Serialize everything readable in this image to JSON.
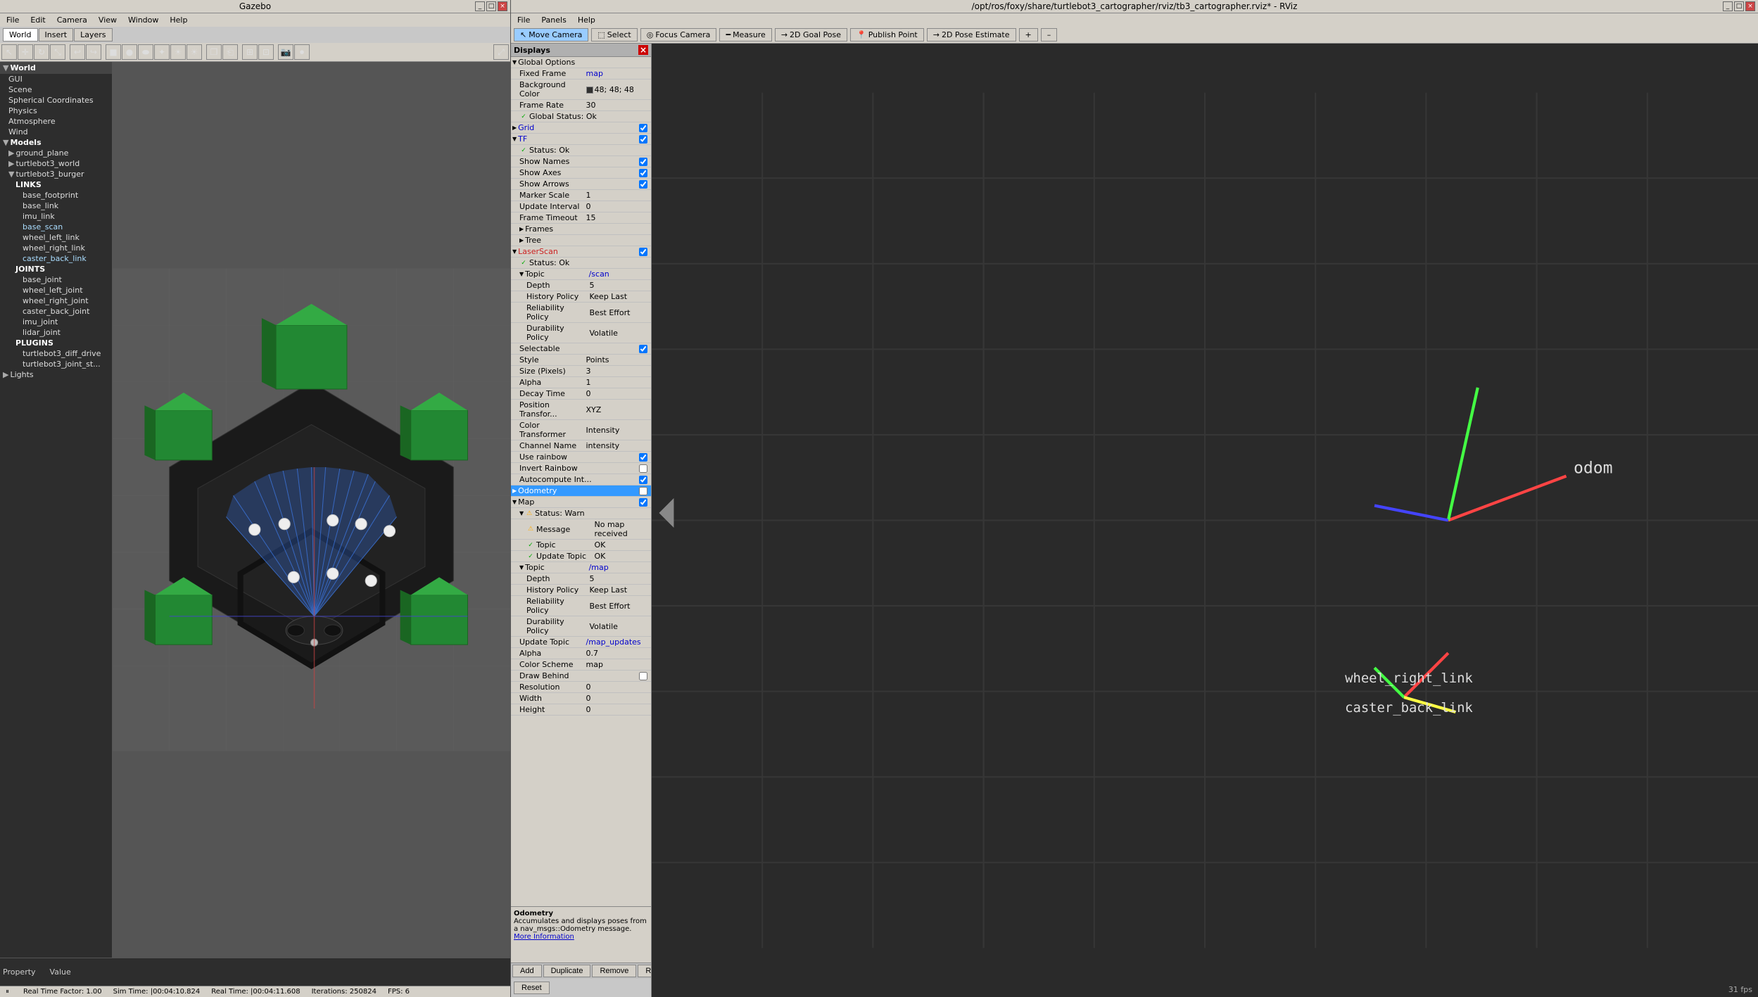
{
  "gazebo": {
    "title": "Gazebo",
    "menubar": [
      "File",
      "Edit",
      "Camera",
      "View",
      "Window",
      "Help"
    ],
    "tabs": [
      "World",
      "Insert",
      "Layers"
    ],
    "active_tab": "World",
    "sidebar": {
      "world_items": [
        {
          "label": "GUI",
          "indent": 1
        },
        {
          "label": "Scene",
          "indent": 1
        },
        {
          "label": "Spherical Coordinates",
          "indent": 1
        },
        {
          "label": "Physics",
          "indent": 1
        },
        {
          "label": "Atmosphere",
          "indent": 1
        },
        {
          "label": "Wind",
          "indent": 1
        },
        {
          "label": "Models",
          "indent": 0,
          "bold": true,
          "expanded": true
        },
        {
          "label": "ground_plane",
          "indent": 1
        },
        {
          "label": "turtlebot3_world",
          "indent": 1
        },
        {
          "label": "turtlebot3_burger",
          "indent": 1,
          "expanded": true
        },
        {
          "label": "LINKS",
          "indent": 2,
          "bold": true
        },
        {
          "label": "base_footprint",
          "indent": 3
        },
        {
          "label": "base_link",
          "indent": 3
        },
        {
          "label": "imu_link",
          "indent": 3
        },
        {
          "label": "base_scan",
          "indent": 3
        },
        {
          "label": "wheel_left_link",
          "indent": 3
        },
        {
          "label": "wheel_right_link",
          "indent": 3
        },
        {
          "label": "caster_back_link",
          "indent": 3
        },
        {
          "label": "JOINTS",
          "indent": 2,
          "bold": true
        },
        {
          "label": "base_joint",
          "indent": 3
        },
        {
          "label": "wheel_left_joint",
          "indent": 3
        },
        {
          "label": "wheel_right_joint",
          "indent": 3
        },
        {
          "label": "caster_back_joint",
          "indent": 3
        },
        {
          "label": "imu_joint",
          "indent": 3
        },
        {
          "label": "lidar_joint",
          "indent": 3
        },
        {
          "label": "PLUGINS",
          "indent": 2,
          "bold": true
        },
        {
          "label": "turtlebot3_diff_drive",
          "indent": 3
        },
        {
          "label": "turtlebot3_joint_st...",
          "indent": 3
        },
        {
          "label": "Lights",
          "indent": 0,
          "bold": false
        }
      ]
    },
    "props": {
      "property_label": "Property",
      "value_label": "Value"
    },
    "status": {
      "real_time_factor": "Real Time Factor: 1.00",
      "sim_time": "Sim Time: |00:04:10.824",
      "real_time": "Real Time: |00:04:11.608",
      "iterations": "Iterations: 250824",
      "fps": "FPS: 6"
    }
  },
  "rviz": {
    "title": "/opt/ros/foxy/share/turtlebot3_cartographer/rviz/tb3_cartographer.rviz* - RViz",
    "menubar": [
      "File",
      "Panels",
      "Help"
    ],
    "tools": [
      {
        "label": "Move Camera",
        "active": true,
        "icon": "↖"
      },
      {
        "label": "Select",
        "active": false,
        "icon": "⬚"
      },
      {
        "label": "Focus Camera",
        "active": false,
        "icon": "◎"
      },
      {
        "label": "Measure",
        "active": false,
        "icon": "📏"
      },
      {
        "label": "2D Goal Pose",
        "active": false,
        "icon": "→"
      },
      {
        "label": "Publish Point",
        "active": false,
        "icon": "📍"
      },
      {
        "label": "2D Pose Estimate",
        "active": false,
        "icon": "→"
      },
      {
        "label": "+",
        "active": false
      },
      {
        "label": "–",
        "active": false
      }
    ],
    "displays": {
      "header": "Displays",
      "items": [
        {
          "indent": 0,
          "type": "section",
          "label": "Global Options",
          "expanded": true
        },
        {
          "indent": 1,
          "label": "Fixed Frame",
          "value": "map"
        },
        {
          "indent": 1,
          "label": "Background Color",
          "value": "48; 48; 48",
          "color_swatch": "#303030"
        },
        {
          "indent": 1,
          "label": "Frame Rate",
          "value": "30"
        },
        {
          "indent": 1,
          "label": "Global Status: Ok",
          "status": "ok"
        },
        {
          "indent": 0,
          "type": "section",
          "label": "Grid",
          "value": "✓",
          "color": "blue"
        },
        {
          "indent": 0,
          "type": "section",
          "label": "TF",
          "value": "✓",
          "color": "blue"
        },
        {
          "indent": 1,
          "label": "✓ Status: Ok",
          "status": "ok"
        },
        {
          "indent": 1,
          "label": "Show Names",
          "value": "✓"
        },
        {
          "indent": 1,
          "label": "Show Axes",
          "value": "✓"
        },
        {
          "indent": 1,
          "label": "Show Arrows",
          "value": "✓"
        },
        {
          "indent": 1,
          "label": "Marker Scale",
          "value": "1"
        },
        {
          "indent": 1,
          "label": "Update Interval",
          "value": "0"
        },
        {
          "indent": 1,
          "label": "Frame Timeout",
          "value": "15"
        },
        {
          "indent": 1,
          "label": "Frames",
          "value": ""
        },
        {
          "indent": 1,
          "label": "Tree",
          "value": ""
        },
        {
          "indent": 0,
          "type": "section",
          "label": "LaserScan",
          "value": "✓",
          "color": "red"
        },
        {
          "indent": 1,
          "label": "✓ Status: Ok",
          "status": "ok"
        },
        {
          "indent": 1,
          "label": "Topic",
          "value": "/scan"
        },
        {
          "indent": 2,
          "label": "Depth",
          "value": "5"
        },
        {
          "indent": 2,
          "label": "History Policy",
          "value": "Keep Last"
        },
        {
          "indent": 2,
          "label": "Reliability Policy",
          "value": "Best Effort"
        },
        {
          "indent": 2,
          "label": "Durability Policy",
          "value": "Volatile"
        },
        {
          "indent": 1,
          "label": "Selectable",
          "value": "✓"
        },
        {
          "indent": 1,
          "label": "Style",
          "value": "Points"
        },
        {
          "indent": 1,
          "label": "Size (Pixels)",
          "value": "3"
        },
        {
          "indent": 1,
          "label": "Alpha",
          "value": "1"
        },
        {
          "indent": 1,
          "label": "Decay Time",
          "value": "0"
        },
        {
          "indent": 1,
          "label": "Position Transfor...",
          "value": "XYZ"
        },
        {
          "indent": 1,
          "label": "Color Transformer",
          "value": "Intensity"
        },
        {
          "indent": 1,
          "label": "Channel Name",
          "value": "intensity"
        },
        {
          "indent": 1,
          "label": "Use rainbow",
          "value": "✓"
        },
        {
          "indent": 1,
          "label": "Invert Rainbow",
          "value": ""
        },
        {
          "indent": 1,
          "label": "Autocompute Int...",
          "value": "✓"
        },
        {
          "indent": 0,
          "type": "section",
          "label": "Odometry",
          "selected": true
        },
        {
          "indent": 0,
          "type": "section",
          "label": "Map",
          "value": "✓"
        },
        {
          "indent": 1,
          "label": "✓ Status: Warn",
          "status": "warn"
        },
        {
          "indent": 2,
          "label": "Message",
          "value": "No map received"
        },
        {
          "indent": 2,
          "label": "✓ Topic",
          "value": "OK"
        },
        {
          "indent": 2,
          "label": "✓ Update Topic",
          "value": "OK"
        },
        {
          "indent": 1,
          "label": "Topic",
          "value": "/map"
        },
        {
          "indent": 2,
          "label": "Depth",
          "value": "5"
        },
        {
          "indent": 2,
          "label": "History Policy",
          "value": "Keep Last"
        },
        {
          "indent": 2,
          "label": "Reliability Policy",
          "value": "Best Effort"
        },
        {
          "indent": 2,
          "label": "Durability Policy",
          "value": "Volatile"
        },
        {
          "indent": 1,
          "label": "Update Topic",
          "value": "/map_updates"
        },
        {
          "indent": 1,
          "label": "Alpha",
          "value": "0.7"
        },
        {
          "indent": 1,
          "label": "Color Scheme",
          "value": "map"
        },
        {
          "indent": 1,
          "label": "Draw Behind",
          "value": ""
        },
        {
          "indent": 1,
          "label": "Resolution",
          "value": "0"
        },
        {
          "indent": 1,
          "label": "Width",
          "value": "0"
        },
        {
          "indent": 1,
          "label": "Height",
          "value": "0"
        }
      ],
      "info_text": "Odometry\nAccumulates and displays poses from a nav_msgs::Odometry message.",
      "info_link": "More Information",
      "buttons": [
        "Add",
        "Duplicate",
        "Remove",
        "Rename"
      ],
      "reset_label": "Reset"
    },
    "fps": "31 fps"
  }
}
